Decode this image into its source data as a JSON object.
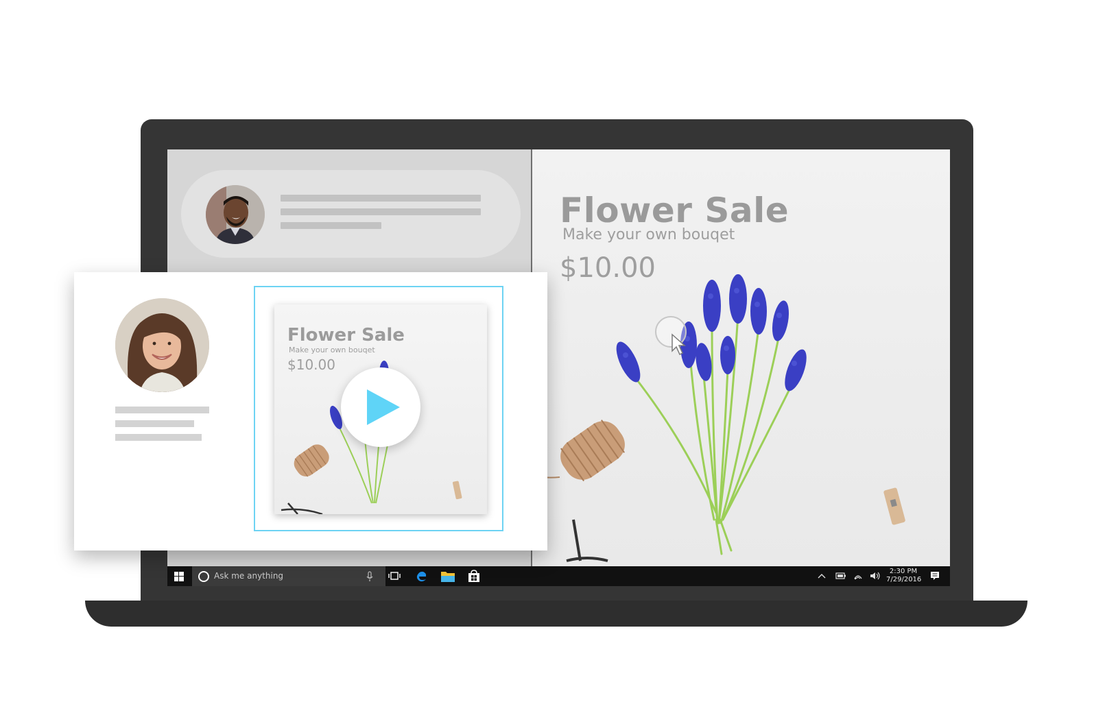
{
  "product": {
    "title": "Flower Sale",
    "subtitle": "Make your own bouqet",
    "price": "$10.00"
  },
  "taskbar": {
    "search_placeholder": "Ask me anything",
    "time": "2:30 PM",
    "date": "7/29/2016"
  },
  "icons": {
    "start": "windows-start-icon",
    "search": "cortana-icon",
    "mic": "microphone-icon",
    "task_view": "task-view-icon",
    "browser": "edge-icon",
    "files": "file-explorer-icon",
    "store": "store-icon",
    "tray_up": "chevron-up-icon",
    "battery": "battery-icon",
    "wifi": "wifi-icon",
    "volume": "volume-icon",
    "notifications": "action-center-icon",
    "play": "play-icon",
    "cursor": "mouse-cursor-icon"
  },
  "colors": {
    "accent": "#6dd3f3",
    "play": "#5fd4f7",
    "flower": "#3a3fc4",
    "taskbar": "#111111"
  }
}
